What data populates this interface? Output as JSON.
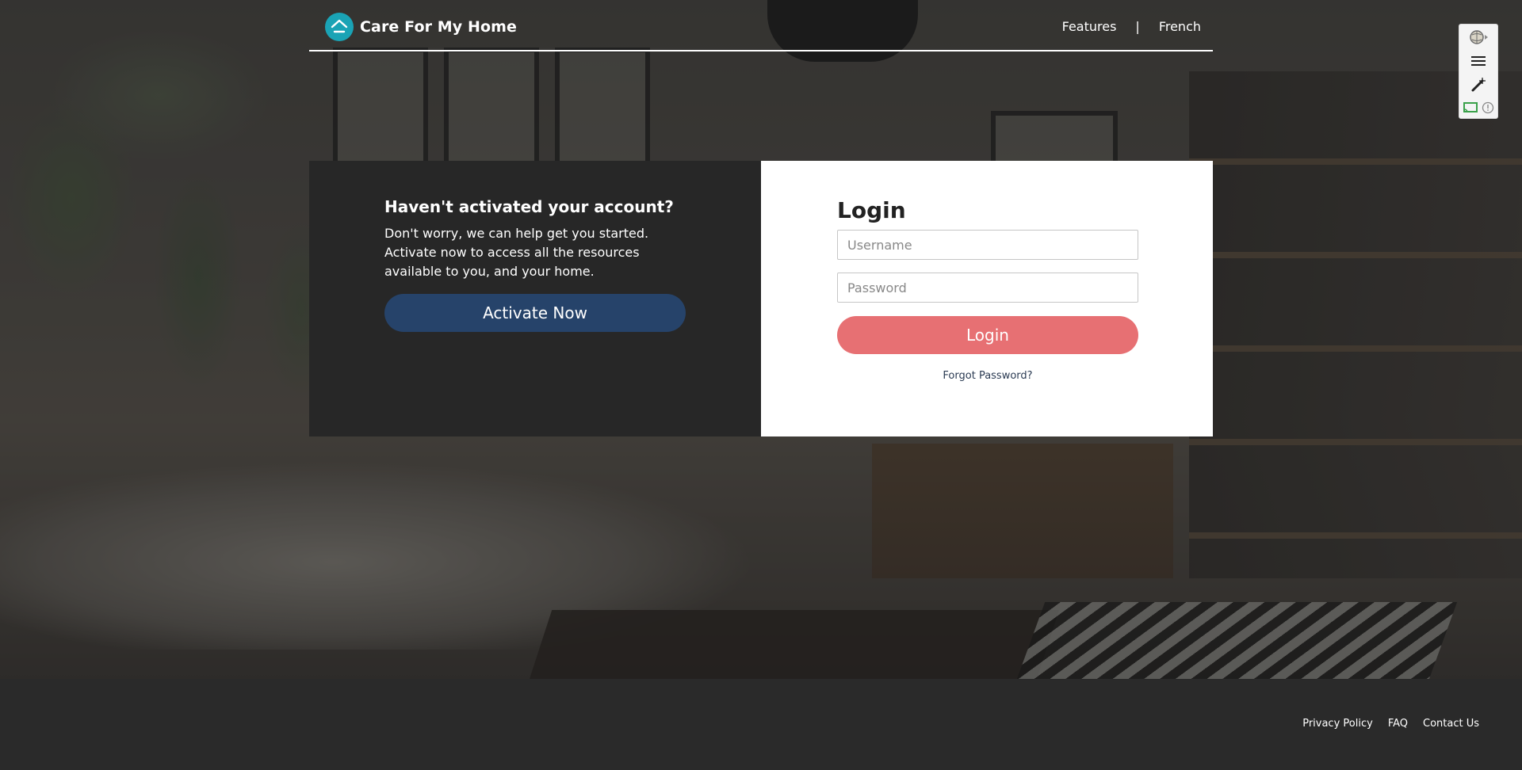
{
  "brand": {
    "name": "Care For My Home",
    "logo_icon": "house-icon",
    "logo_color": "#1aa3b5"
  },
  "nav": {
    "features": "Features",
    "separator": "|",
    "language": "French"
  },
  "activate": {
    "heading": "Haven't activated your account?",
    "text": "Don't worry, we can help get you started. Activate now to access all the resources available to you, and your home.",
    "button": "Activate Now",
    "button_color": "#26436a"
  },
  "login": {
    "title": "Login",
    "username_placeholder": "Username",
    "password_placeholder": "Password",
    "button": "Login",
    "button_color": "#e77073",
    "forgot": "Forgot Password?"
  },
  "footer": {
    "links": [
      "Privacy Policy",
      "FAQ",
      "Contact Us"
    ]
  },
  "extension_toolbar": {
    "icons": [
      "globe-icon",
      "menu-icon",
      "magic-wand-icon",
      "cast-icon",
      "info-icon"
    ]
  }
}
